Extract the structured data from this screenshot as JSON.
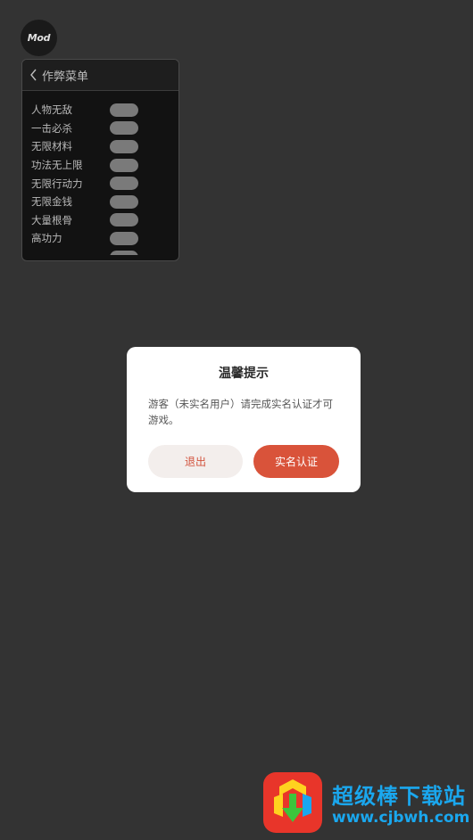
{
  "mod_button": {
    "label": "Mod"
  },
  "cheat_menu": {
    "title": "作弊菜单",
    "items": [
      {
        "label": "人物无敌",
        "enabled": false
      },
      {
        "label": "一击必杀",
        "enabled": false
      },
      {
        "label": "无限材料",
        "enabled": false
      },
      {
        "label": "功法无上限",
        "enabled": false
      },
      {
        "label": "无限行动力",
        "enabled": false
      },
      {
        "label": "无限金钱",
        "enabled": false
      },
      {
        "label": "大量根骨",
        "enabled": false
      },
      {
        "label": "高功力",
        "enabled": false
      }
    ]
  },
  "dialog": {
    "title": "温馨提示",
    "message": "游客（未实名用户）请完成实名认证才可游戏。",
    "exit_label": "退出",
    "verify_label": "实名认证"
  },
  "watermark": {
    "brand": "超级棒下载站",
    "url": "www.cjbwh.com"
  },
  "colors": {
    "background": "#333333",
    "accent": "#d9533a",
    "watermark": "#1aa7ee"
  }
}
